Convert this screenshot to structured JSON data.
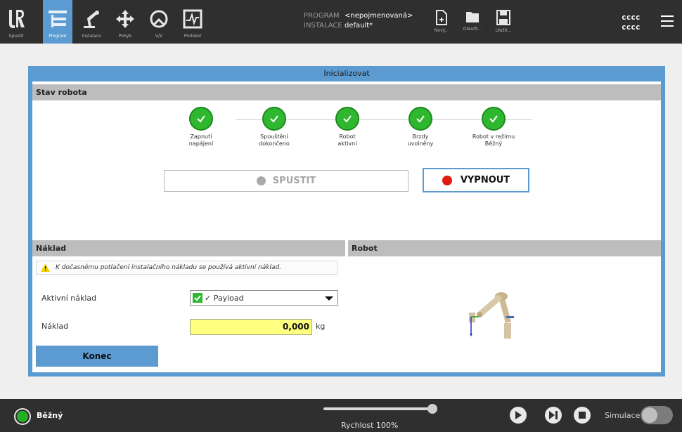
{
  "nav": {
    "items": [
      {
        "label": "Spustit",
        "icon": "ur-logo-icon"
      },
      {
        "label": "Program",
        "icon": "program-tree-icon",
        "active": true
      },
      {
        "label": "Instalace",
        "icon": "robot-arm-icon"
      },
      {
        "label": "Pohyb",
        "icon": "move-arrows-icon"
      },
      {
        "label": "V/V",
        "icon": "io-icon"
      },
      {
        "label": "Protokol",
        "icon": "log-chart-icon"
      }
    ]
  },
  "program_info": {
    "program_key": "PROGRAM",
    "program_value": "<nepojmenovaná>",
    "installation_key": "INSTALACE",
    "installation_value": "default*"
  },
  "file_buttons": [
    {
      "label": "Nový...",
      "icon": "new-file-icon"
    },
    {
      "label": "Otevřít...",
      "icon": "open-folder-icon"
    },
    {
      "label": "Uložit...",
      "icon": "save-disk-icon"
    }
  ],
  "user": {
    "line1": "cccc",
    "line2": "cccc"
  },
  "dialog": {
    "title": "Inicializovat",
    "robot_state_header": "Stav robota",
    "steps": [
      {
        "label": "Zapnutí napájení",
        "status": "done"
      },
      {
        "label": "Spouštění dokončeno",
        "status": "done"
      },
      {
        "label": "Robot aktivní",
        "status": "done"
      },
      {
        "label": "Brzdy uvolněny",
        "status": "done"
      },
      {
        "label": "Robot v režimu Běžný",
        "status": "done"
      }
    ],
    "start_button": "SPUSTIT",
    "off_button": "VYPNOUT",
    "payload_header": "Náklad",
    "robot_header": "Robot",
    "warning": "K dočasnému potlačení instalačního nákladu se používá aktivní náklad.",
    "active_payload_label": "Aktivní náklad",
    "active_payload_value": "✓ Payload",
    "payload_label": "Náklad",
    "payload_value": "0,000",
    "payload_unit": "kg",
    "end_button": "Konec"
  },
  "status": {
    "mode": "Běžný",
    "speed_label": "Rychlost 100%",
    "speed_fraction": 1.0,
    "simulation_label": "Simulace",
    "simulation_on": false
  },
  "colors": {
    "accent": "#5c9bd1",
    "topbar": "#2f2f2f",
    "success": "#2fb82f",
    "danger": "#e11b0f",
    "payload_input": "#ffff80"
  }
}
